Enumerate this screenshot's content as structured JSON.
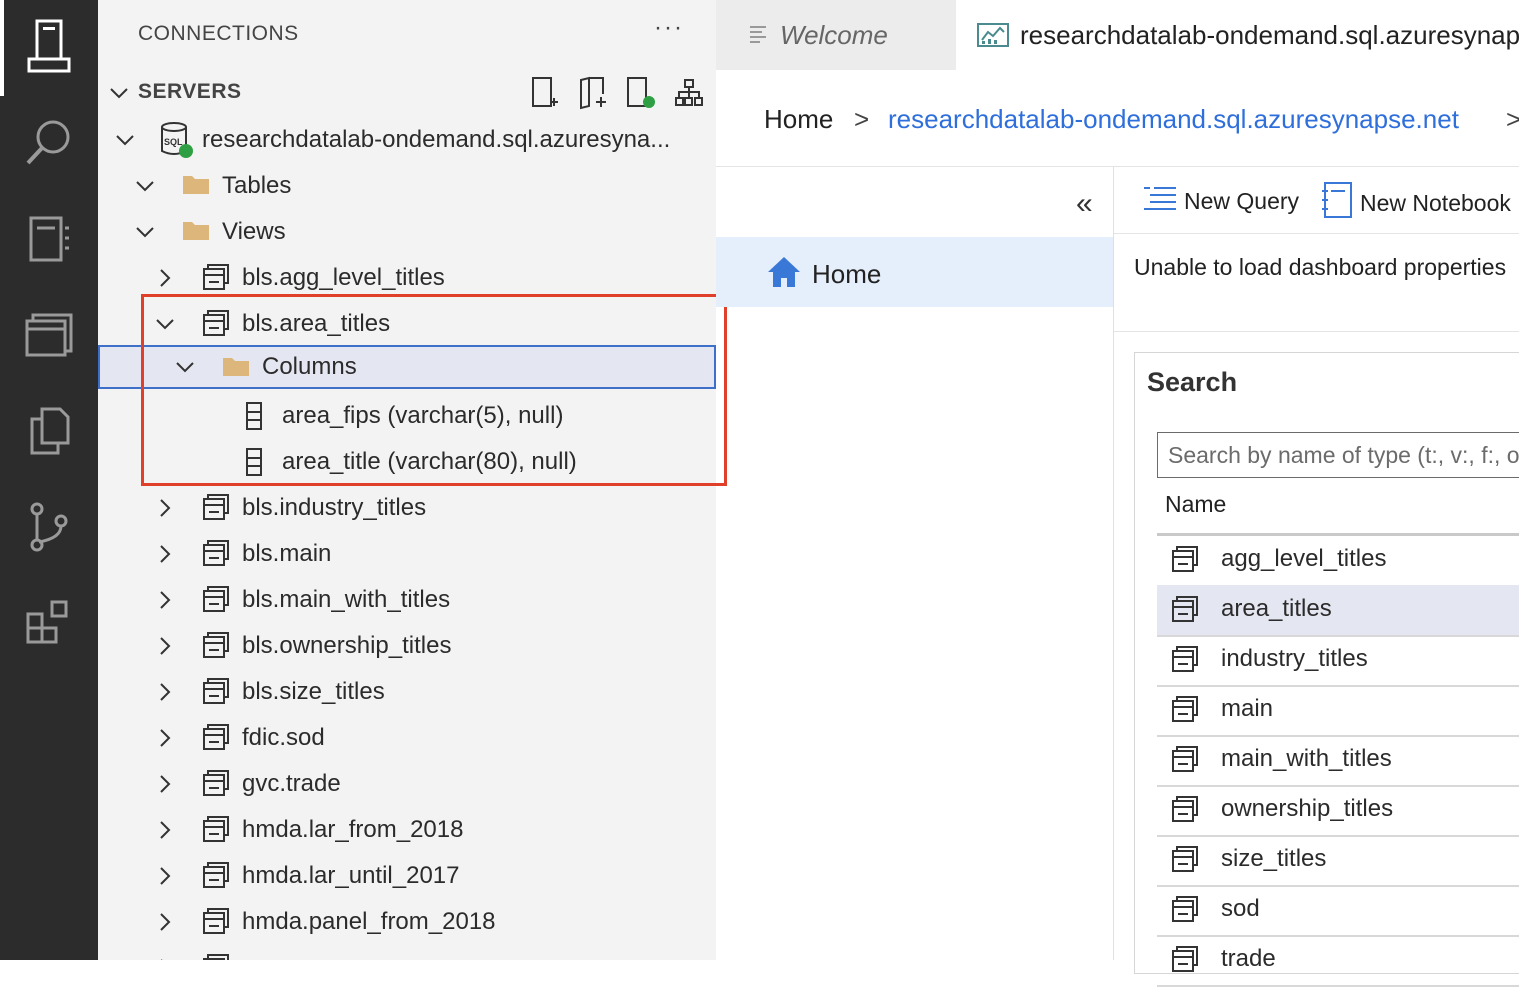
{
  "activity_bar": {
    "items": [
      "connections-icon",
      "search-icon",
      "notebook-icon",
      "windows-icon",
      "copy-icon",
      "source-control-icon",
      "extensions-icon"
    ]
  },
  "sidebar": {
    "header": "CONNECTIONS",
    "more": "···",
    "servers_label": "SERVERS",
    "server_name": "researchdatalab-ondemand.sql.azuresyna...",
    "nodes": {
      "tables": "Tables",
      "views": "Views",
      "view1": "bls.agg_level_titles",
      "view2": "bls.area_titles",
      "columns": "Columns",
      "col1": "area_fips (varchar(5), null)",
      "col2": "area_title (varchar(80), null)",
      "view3": "bls.industry_titles",
      "view4": "bls.main",
      "view5": "bls.main_with_titles",
      "view6": "bls.ownership_titles",
      "view7": "bls.size_titles",
      "view8": "fdic.sod",
      "view9": "gvc.trade",
      "view10": "hmda.lar_from_2018",
      "view11": "hmda.lar_until_2017",
      "view12": "hmda.panel_from_2018"
    }
  },
  "tabs": {
    "welcome": "Welcome",
    "active": "researchdatalab-ondemand.sql.azuresynapse.net"
  },
  "breadcrumb": {
    "home": "Home",
    "sep": ">",
    "server": "researchdatalab-ondemand.sql.azuresynapse.net",
    "sep2": ">"
  },
  "dashboard": {
    "collapse": "«",
    "home_label": "Home",
    "new_query": "New Query",
    "new_notebook": "New Notebook",
    "message": "Unable to load dashboard properties",
    "search_title": "Search",
    "search_placeholder": "Search by name of type (t:, v:, f:, or sp:)",
    "name_header": "Name",
    "items": [
      "agg_level_titles",
      "area_titles",
      "industry_titles",
      "main",
      "main_with_titles",
      "ownership_titles",
      "size_titles",
      "sod",
      "trade"
    ]
  },
  "colors": {
    "accent": "#3e6fc9",
    "highlight": "#e0402a",
    "link": "#2f6fdb",
    "status_online": "#2ea043"
  }
}
